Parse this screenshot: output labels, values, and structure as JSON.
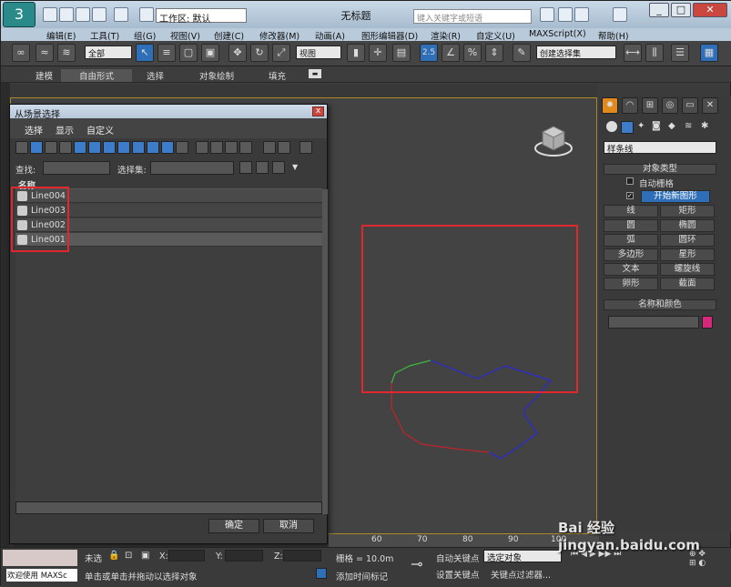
{
  "app": {
    "title": "无标题",
    "workspace": "工作区: 默认",
    "search_placeholder": "键入关键字或短语"
  },
  "menubar": [
    "编辑(E)",
    "工具(T)",
    "组(G)",
    "视图(V)",
    "创建(C)",
    "修改器(M)",
    "动画(A)",
    "图形编辑器(D)",
    "渲染(R)",
    "自定义(U)",
    "MAXScript(X)",
    "帮助(H)"
  ],
  "toolbar": {
    "selection_filter": "全部",
    "ref_coord": "视图",
    "named_sel": "创建选择集",
    "snap_label": "2.5"
  },
  "ribbon": [
    "建模",
    "自由形式",
    "选择",
    "对象绘制",
    "填充"
  ],
  "dialog": {
    "title": "从场景选择",
    "menu": [
      "选择",
      "显示",
      "自定义"
    ],
    "find_label": "查找:",
    "selset_label": "选择集:",
    "col_name": "名称",
    "rows": [
      "Line004",
      "Line003",
      "Line002",
      "Line001"
    ],
    "ok": "确定",
    "cancel": "取消"
  },
  "cmdpanel": {
    "category": "样条线",
    "object_type_head": "对象类型",
    "auto_grid": "自动栅格",
    "start_new_shape": "开始新图形",
    "buttons": [
      [
        "线",
        "矩形"
      ],
      [
        "圆",
        "椭圆"
      ],
      [
        "弧",
        "圆环"
      ],
      [
        "多边形",
        "星形"
      ],
      [
        "文本",
        "螺旋线"
      ],
      [
        "卵形",
        "截面"
      ]
    ],
    "name_color_head": "名称和颜色",
    "object_color": "#d6297c"
  },
  "timeline": {
    "ticks": [
      "60",
      "70",
      "80",
      "90",
      "100"
    ]
  },
  "status": {
    "welcome": "欢迎使用 MAXSc",
    "none_selected": "未选",
    "prompt": "单击或单击并拖动以选择对象",
    "x": "X:",
    "y": "Y:",
    "z": "Z:",
    "grid": "栅格 = 10.0m",
    "add_time_tag": "添加时间标记",
    "auto_key": "自动关键点",
    "set_key": "设置关键点",
    "key_filter": "关键点过滤器...",
    "selected_object": "选定对象"
  },
  "watermark": "Bai 经验 jingyan.baidu.com",
  "colors": {
    "highlight_red": "#e0272e",
    "accent_blue": "#2f6fb8",
    "viewport_bg": "#434343"
  }
}
